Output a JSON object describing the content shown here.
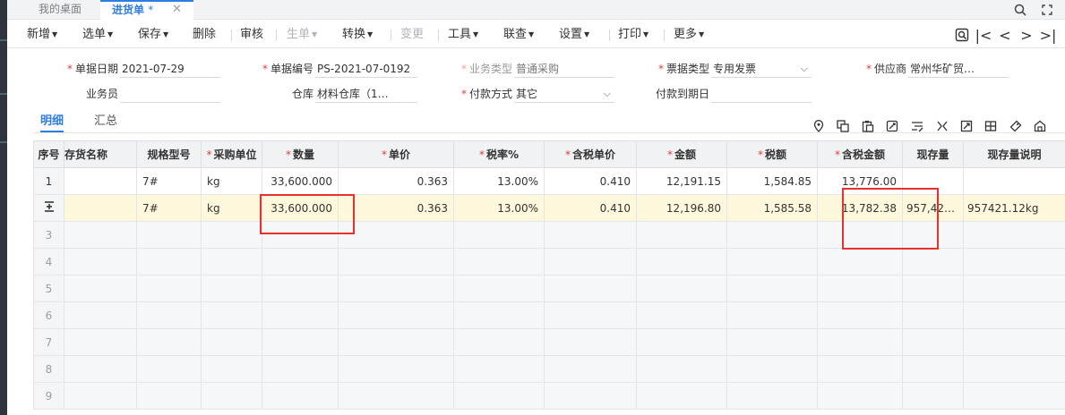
{
  "tabs": {
    "home": "我的桌面",
    "active": "进货单",
    "active_dirty": "*",
    "close": "✕"
  },
  "toolbar": [
    {
      "label": "新增",
      "caret": true,
      "disabled": false
    },
    {
      "label": "选单",
      "caret": true,
      "disabled": false
    },
    {
      "label": "保存",
      "caret": true,
      "disabled": false
    },
    {
      "label": "删除",
      "caret": false,
      "disabled": false
    },
    {
      "label": "审核",
      "caret": false,
      "disabled": false
    },
    {
      "label": "生单",
      "caret": true,
      "disabled": true
    },
    {
      "label": "转换",
      "caret": true,
      "disabled": false
    },
    {
      "label": "变更",
      "caret": false,
      "disabled": true
    },
    {
      "label": "工具",
      "caret": true,
      "disabled": false
    },
    {
      "label": "联查",
      "caret": true,
      "disabled": false
    },
    {
      "label": "设置",
      "caret": true,
      "disabled": false
    },
    {
      "label": "打印",
      "caret": true,
      "disabled": false
    },
    {
      "label": "更多",
      "caret": true,
      "disabled": false
    }
  ],
  "nav": {
    "first": "|<",
    "prev": "<",
    "next": ">",
    "last": ">|"
  },
  "form": {
    "date_label": "单据日期",
    "date_value": "2021-07-29",
    "code_label": "单据编号",
    "code_value": "PS-2021-07-0192",
    "biztype_label": "业务类型",
    "biztype_value": "普通采购",
    "invtype_label": "票据类型",
    "invtype_value": "专用发票",
    "supplier_label": "供应商",
    "supplier_value": "常州华矿贸…",
    "clerk_label": "业务员",
    "clerk_value": "",
    "warehouse_label": "仓库",
    "warehouse_value": "材料仓库（1…",
    "payment_label": "付款方式",
    "payment_value": "其它",
    "duedate_label": "付款到期日",
    "duedate_value": ""
  },
  "subtabs": {
    "detail": "明细",
    "summary": "汇总"
  },
  "grid": {
    "headers": {
      "seq": "序号",
      "name": "存货名称",
      "spec": "规格型号",
      "unit": "采购单位",
      "qty": "数量",
      "price": "单价",
      "taxrate": "税率%",
      "taxprice": "含税单价",
      "amount": "金额",
      "tax": "税额",
      "taxamount": "含税金额",
      "stock": "现存量",
      "stocknote": "现存量说明"
    },
    "rows": [
      {
        "seq": "1",
        "name": "",
        "spec": "7#",
        "unit": "kg",
        "qty": "33,600.000",
        "price": "0.363",
        "taxrate": "13.00%",
        "taxprice": "0.410",
        "amount": "12,191.15",
        "tax": "1,584.85",
        "taxamount": "13,776.00",
        "stock": "",
        "stocknote": ""
      },
      {
        "seq": "",
        "name": "",
        "spec": "7#",
        "unit": "kg",
        "qty": "33,600.000",
        "price": "0.363",
        "taxrate": "13.00%",
        "taxprice": "0.410",
        "amount": "12,196.80",
        "tax": "1,585.58",
        "taxamount": "13,782.38",
        "stock": "957,42…",
        "stocknote": "957421.12kg"
      }
    ],
    "empty_rows": [
      "3",
      "4",
      "5",
      "6",
      "7",
      "8",
      "9"
    ]
  }
}
